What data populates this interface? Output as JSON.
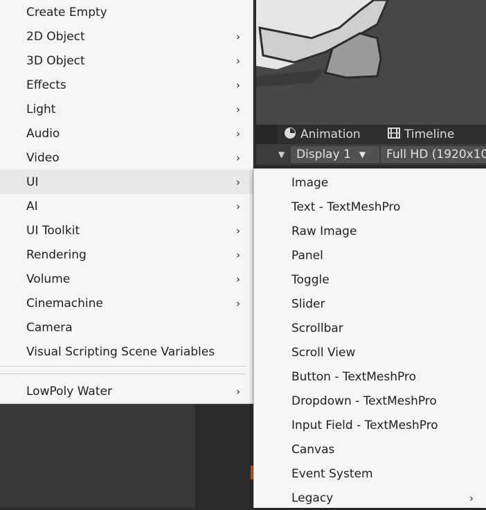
{
  "main_menu": {
    "items": [
      {
        "label": "Create Empty",
        "submenu": false
      },
      {
        "label": "2D Object",
        "submenu": true
      },
      {
        "label": "3D Object",
        "submenu": true
      },
      {
        "label": "Effects",
        "submenu": true
      },
      {
        "label": "Light",
        "submenu": true
      },
      {
        "label": "Audio",
        "submenu": true
      },
      {
        "label": "Video",
        "submenu": true
      },
      {
        "label": "UI",
        "submenu": true,
        "active": true
      },
      {
        "label": "AI",
        "submenu": true
      },
      {
        "label": "UI Toolkit",
        "submenu": true
      },
      {
        "label": "Rendering",
        "submenu": true
      },
      {
        "label": "Volume",
        "submenu": true
      },
      {
        "label": "Cinemachine",
        "submenu": true
      },
      {
        "label": "Camera",
        "submenu": false
      },
      {
        "label": "Visual Scripting Scene Variables",
        "submenu": false
      }
    ],
    "after_separator": [
      {
        "label": "LowPoly Water",
        "submenu": true
      }
    ]
  },
  "ui_submenu": {
    "items": [
      {
        "label": "Image",
        "submenu": false
      },
      {
        "label": "Text - TextMeshPro",
        "submenu": false
      },
      {
        "label": "Raw Image",
        "submenu": false
      },
      {
        "label": "Panel",
        "submenu": false
      },
      {
        "label": "Toggle",
        "submenu": false
      },
      {
        "label": "Slider",
        "submenu": false
      },
      {
        "label": "Scrollbar",
        "submenu": false
      },
      {
        "label": "Scroll View",
        "submenu": false
      },
      {
        "label": "Button - TextMeshPro",
        "submenu": false
      },
      {
        "label": "Dropdown - TextMeshPro",
        "submenu": false
      },
      {
        "label": "Input Field - TextMeshPro",
        "submenu": false
      },
      {
        "label": "Canvas",
        "submenu": false
      },
      {
        "label": "Event System",
        "submenu": false
      },
      {
        "label": "Legacy",
        "submenu": true
      }
    ]
  },
  "editor": {
    "tabs": [
      {
        "label": "Animation",
        "icon": "clock-icon"
      },
      {
        "label": "Timeline",
        "icon": "film-icon"
      }
    ],
    "display_select": "Display 1",
    "resolution_select": "Full HD (1920x10"
  },
  "chevron_glyph": "›",
  "caret_glyph": "▼",
  "colors": {
    "menu_bg": "#f5f5f5",
    "menu_active": "#e8e8e8",
    "editor_dark": "#2e2e2e",
    "accent": "#b85a2a"
  }
}
